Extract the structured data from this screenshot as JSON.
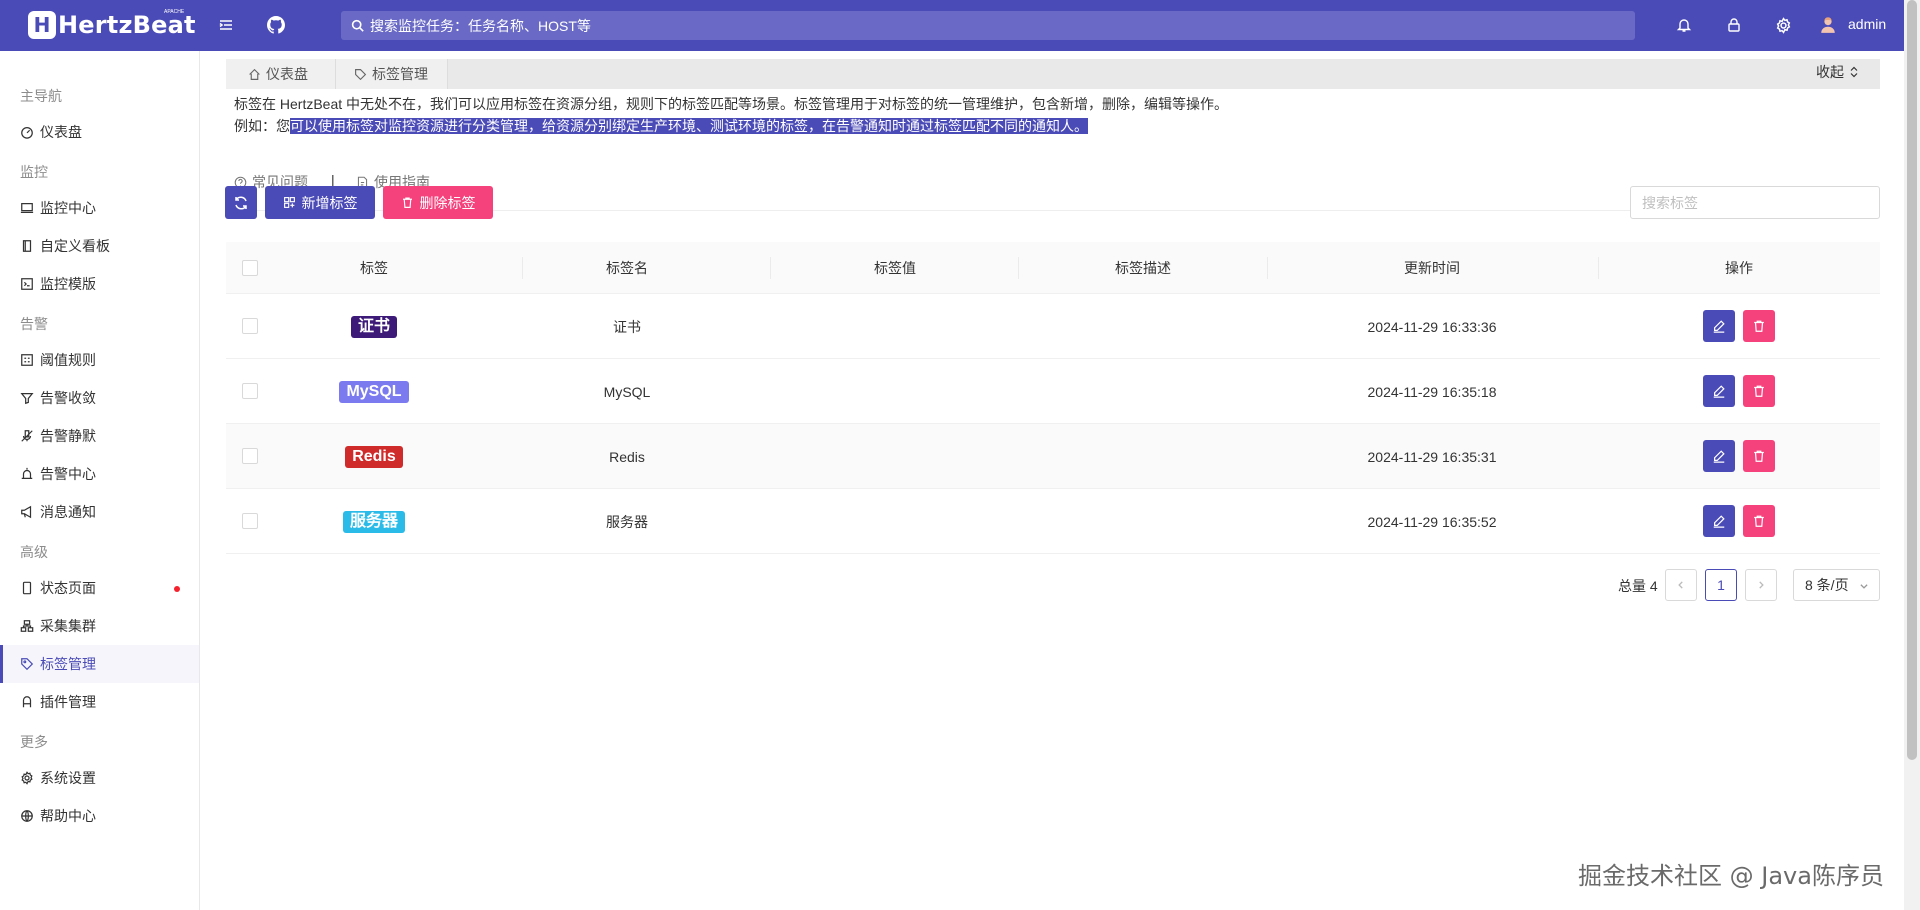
{
  "header": {
    "logo_mark": "H",
    "logo_text": "HertzBeat",
    "logo_sup": "APACHE",
    "search_placeholder": "搜索监控任务：任务名称、HOST等",
    "user": "admin"
  },
  "sidebar": {
    "groups": {
      "main": "主导航",
      "monitor": "监控",
      "alert": "告警",
      "advanced": "高级",
      "more": "更多"
    },
    "items": {
      "dashboard": "仪表盘",
      "monitor_center": "监控中心",
      "custom_board": "自定义看板",
      "monitor_template": "监控模版",
      "threshold_rules": "阈值规则",
      "alert_converge": "告警收敛",
      "alert_silence": "告警静默",
      "alert_center": "告警中心",
      "notice": "消息通知",
      "status_page": "状态页面",
      "collector_cluster": "采集集群",
      "tag_manage": "标签管理",
      "plugin_manage": "插件管理",
      "settings": "系统设置",
      "help": "帮助中心"
    }
  },
  "tabs": {
    "dashboard": "仪表盘",
    "tags": "标签管理",
    "collapse": "收起"
  },
  "description": {
    "line1": "标签在 HertzBeat 中无处不在，我们可以应用标签在资源分组，规则下的标签匹配等场景。标签管理用于对标签的统一管理维护，包含新增，删除，编辑等操作。",
    "line2_prefix": "例如：您",
    "line2_highlight": "可以使用标签对监控资源进行分类管理，给资源分别绑定生产环境、测试环境的标签，在告警通知时通过标签匹配不同的通知人。",
    "faq": "常见问题",
    "separator": "|",
    "guide": "使用指南"
  },
  "toolbar": {
    "add": "新增标签",
    "delete": "删除标签",
    "search_placeholder": "搜索标签"
  },
  "table": {
    "headers": {
      "tag": "标签",
      "name": "标签名",
      "value": "标签值",
      "desc": "标签描述",
      "time": "更新时间",
      "ops": "操作"
    },
    "rows": [
      {
        "tag": "证书",
        "tag_color": "#3d1a78",
        "name": "证书",
        "value": "",
        "desc": "",
        "time": "2024-11-29 16:33:36"
      },
      {
        "tag": "MySQL",
        "tag_color": "#7b7bef",
        "name": "MySQL",
        "value": "",
        "desc": "",
        "time": "2024-11-29 16:35:18"
      },
      {
        "tag": "Redis",
        "tag_color": "#cf2b2b",
        "name": "Redis",
        "value": "",
        "desc": "",
        "time": "2024-11-29 16:35:31"
      },
      {
        "tag": "服务器",
        "tag_color": "#2bbbe8",
        "name": "服务器",
        "value": "",
        "desc": "",
        "time": "2024-11-29 16:35:52"
      }
    ]
  },
  "pagination": {
    "total": "总量 4",
    "current": "1",
    "page_size": "8 条/页"
  },
  "watermark": "掘金技术社区 @ Java陈序员",
  "colors": {
    "primary": "#4b4bb7",
    "danger": "#f5427d"
  }
}
